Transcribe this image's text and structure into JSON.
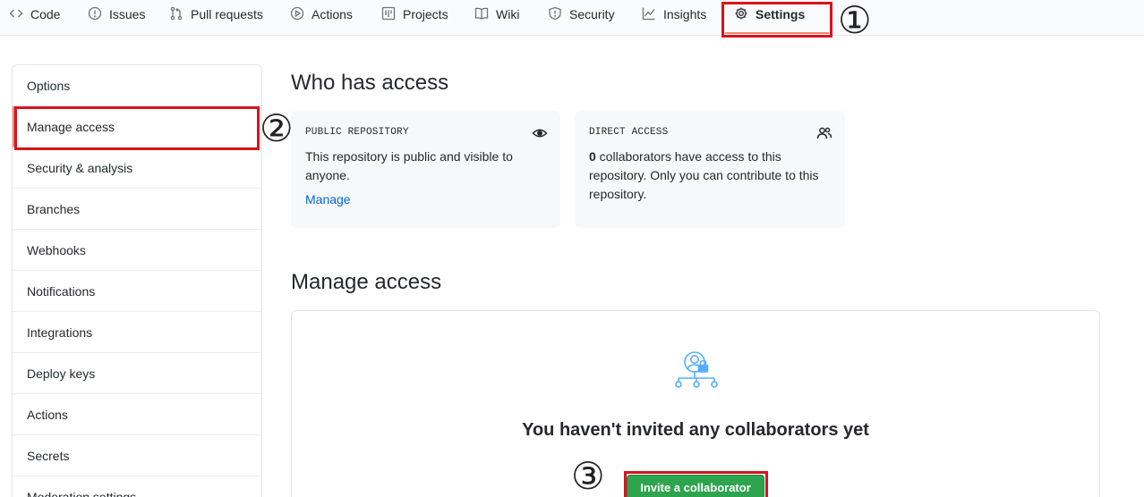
{
  "nav": {
    "tabs": [
      {
        "label": "Code",
        "icon": "code-icon"
      },
      {
        "label": "Issues",
        "icon": "issue-icon"
      },
      {
        "label": "Pull requests",
        "icon": "pull-request-icon"
      },
      {
        "label": "Actions",
        "icon": "play-icon"
      },
      {
        "label": "Projects",
        "icon": "project-icon"
      },
      {
        "label": "Wiki",
        "icon": "book-icon"
      },
      {
        "label": "Security",
        "icon": "shield-icon"
      },
      {
        "label": "Insights",
        "icon": "graph-icon"
      },
      {
        "label": "Settings",
        "icon": "gear-icon",
        "active": true
      }
    ]
  },
  "annotations": [
    "①",
    "②",
    "③"
  ],
  "sidebar": {
    "items": [
      {
        "label": "Options"
      },
      {
        "label": "Manage access",
        "selected": true
      },
      {
        "label": "Security & analysis"
      },
      {
        "label": "Branches"
      },
      {
        "label": "Webhooks"
      },
      {
        "label": "Notifications"
      },
      {
        "label": "Integrations"
      },
      {
        "label": "Deploy keys"
      },
      {
        "label": "Actions"
      },
      {
        "label": "Secrets"
      },
      {
        "label": "Moderation settings"
      }
    ]
  },
  "main": {
    "who_has_access_title": "Who has access",
    "public_card": {
      "title": "PUBLIC REPOSITORY",
      "text": "This repository is public and visible to anyone.",
      "link": "Manage",
      "icon": "eye-icon"
    },
    "direct_card": {
      "title": "DIRECT ACCESS",
      "count": "0",
      "text_rest": " collaborators have access to this repository. Only you can contribute to this repository.",
      "icon": "people-icon"
    },
    "manage_access_title": "Manage access",
    "collaborators": {
      "empty_text": "You haven't invited any collaborators yet",
      "invite_label": "Invite a collaborator",
      "illustration": "collaborators-lock-icon"
    }
  },
  "colors": {
    "accent_underline": "#f9826c",
    "annotation_red": "#d7141e",
    "invite_green": "#2ea44f",
    "link_blue": "#0366d6",
    "illustration_blue": "#54aeff"
  }
}
